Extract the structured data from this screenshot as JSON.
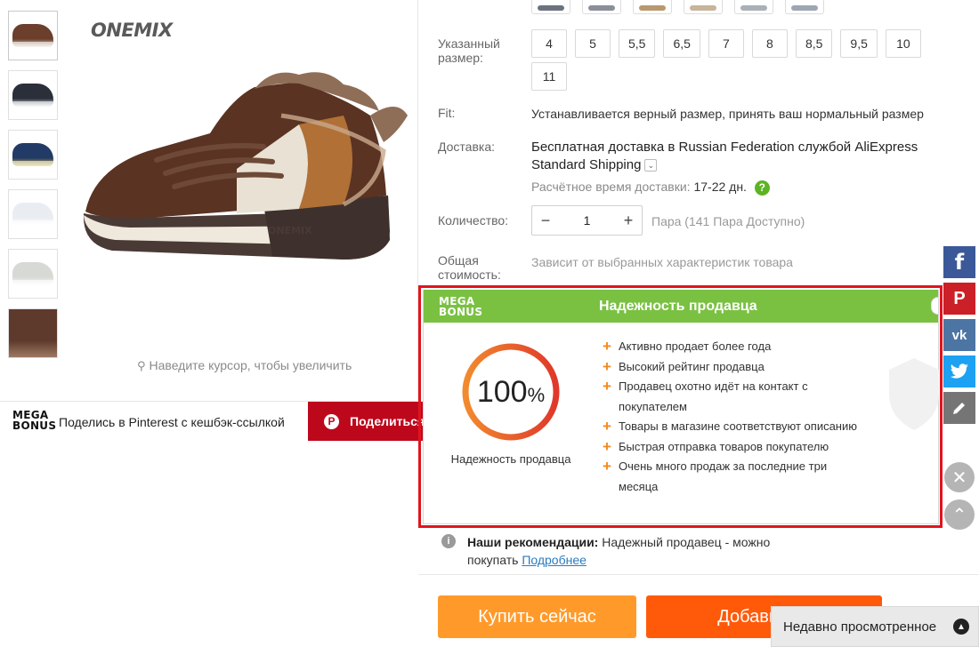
{
  "gallery": {
    "brand": "ONEMIX",
    "zoom_hint": "Наведите курсор, чтобы увеличить",
    "thumbnails": [
      {
        "color": "#6b3f2c",
        "accent": "#e8e0d6"
      },
      {
        "color": "#2a2f3a",
        "accent": "#f2f2f2"
      },
      {
        "color": "#223b66",
        "accent": "#e8c132"
      },
      {
        "color": "#e9edf2",
        "accent": "#ffffff"
      },
      {
        "color": "#d7d9d4",
        "accent": "#ffffff"
      },
      {
        "color": "#5e3a2c",
        "accent": "#a07c67"
      }
    ]
  },
  "share": {
    "logo_line1": "MEGA",
    "logo_line2": "BONUS",
    "text": "Поделись в Pinterest с кешбэк-ссылкой",
    "button_label": "Поделиться"
  },
  "product": {
    "color_swatches": [
      "#6b7380",
      "#8a8f98",
      "#b9986f",
      "#c7b49a",
      "#a9b0b8",
      "#9ea6b3"
    ],
    "size_label": "Указанный размер:",
    "sizes": [
      "4",
      "5",
      "5,5",
      "6,5",
      "7",
      "8",
      "8,5",
      "9,5",
      "10",
      "11"
    ],
    "fit_label": "Fit:",
    "fit_value": "Устанавливается верный размер, принять ваш нормальный размер",
    "shipping_label": "Доставка:",
    "shipping_value": "Бесплатная доставка в Russian Federation службой AliExpress Standard Shipping",
    "shipping_time_prefix": "Расчётное время доставки:",
    "shipping_time_value": "17-22 дн.",
    "qty_label": "Количество:",
    "qty_minus": "−",
    "qty_value": "1",
    "qty_plus": "+",
    "qty_available": "Пара (141 Пара Доступно)",
    "total_label": "Общая стоимость:",
    "total_value": "Зависит от выбранных характеристик товара"
  },
  "reliability": {
    "logo_line1": "MEGA",
    "logo_line2": "BONUS",
    "title": "Надежность продавца",
    "percent": "100",
    "percent_sign": "%",
    "percent_value": 1.0,
    "caption": "Надежность продавца",
    "points": [
      "Активно продает более года",
      "Высокий рейтинг продавца",
      "Продавец охотно идёт на контакт с покупателем",
      "Товары в магазине соответствуют описанию",
      "Быстрая отправка товаров покупателю",
      "Очень много продаж за последние три месяца"
    ]
  },
  "recommendation": {
    "label": "Наши рекомендации:",
    "text": "Надежный продавец - можно покупать",
    "link": "Подробнее"
  },
  "actions": {
    "buy_now": "Купить сейчас",
    "add_to_cart": "Добавить в",
    "recently_viewed": "Недавно просмотренное"
  },
  "social": {
    "facebook": "f",
    "pinterest": "P",
    "vk": "vk"
  }
}
